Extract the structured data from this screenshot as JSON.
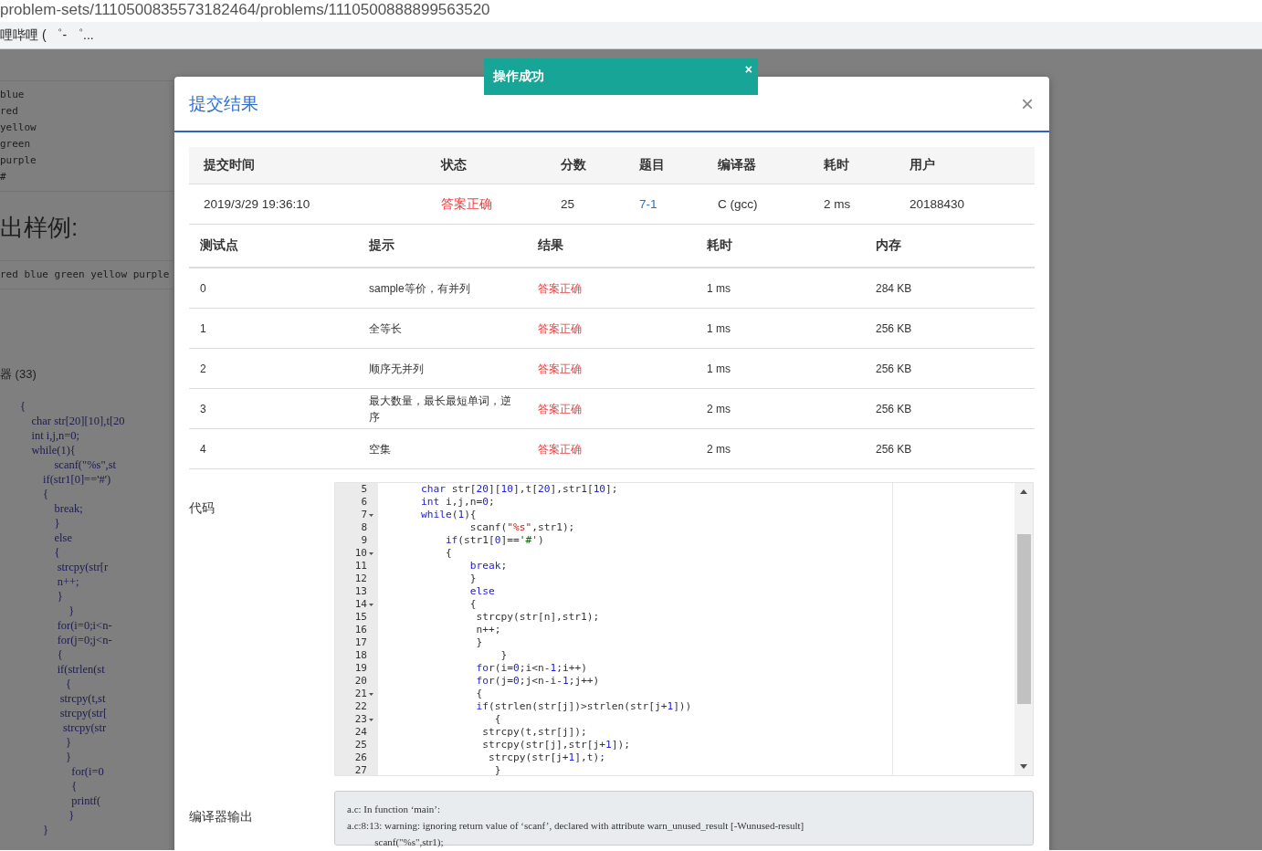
{
  "browser": {
    "url": "problem-sets/1110500835573182464/problems/1110500888899563520",
    "bookmark": "哩哔哩 ( ゜- ゜..."
  },
  "background": {
    "sample_lines": [
      "blue",
      "red",
      "yellow",
      "green",
      "purple",
      "#"
    ],
    "output_heading": "出样例:",
    "output_sample": "red blue green yellow purple",
    "submissions_label": "器 (33)",
    "code_lines": [
      "{",
      "    char str[20][10],t[20",
      "    int i,j,n=0;",
      "    while(1){",
      "            scanf(\"%s\",st",
      "        if(str1[0]=='#')",
      "        {",
      "            break;",
      "            }",
      "            else",
      "            {",
      "             strcpy(str[r",
      "             n++;",
      "             }",
      "                 }",
      "             for(i=0;i<n-",
      "             for(j=0;j<n-",
      "             {",
      "             if(strlen(st",
      "                {",
      "              strcpy(t,st",
      "              strcpy(str[",
      "               strcpy(str",
      "                }",
      "                }",
      "                  for(i=0",
      "                  {",
      "                  printf(",
      "                 }",
      "        }"
    ]
  },
  "toast": {
    "message": "操作成功",
    "close": "×"
  },
  "modal": {
    "title": "提交结果",
    "close": "×",
    "summary": {
      "columns": [
        "提交时间",
        "状态",
        "分数",
        "题目",
        "编译器",
        "耗时",
        "用户"
      ],
      "row": {
        "time": "2019/3/29 19:36:10",
        "status": "答案正确",
        "status_ok": true,
        "score": "25",
        "problem": "7-1",
        "compiler": "C (gcc)",
        "duration": "2 ms",
        "user": "20188430"
      }
    },
    "tests": {
      "columns": [
        "测试点",
        "提示",
        "结果",
        "耗时",
        "内存"
      ],
      "rows": [
        {
          "id": "0",
          "hint": "sample等价，有并列",
          "result": "答案正确",
          "ok": true,
          "time": "1 ms",
          "memory": "284 KB"
        },
        {
          "id": "1",
          "hint": "全等长",
          "result": "答案正确",
          "ok": true,
          "time": "1 ms",
          "memory": "256 KB"
        },
        {
          "id": "2",
          "hint": "顺序无并列",
          "result": "答案正确",
          "ok": true,
          "time": "1 ms",
          "memory": "256 KB"
        },
        {
          "id": "3",
          "hint": "最大数量，最长最短单词，逆序",
          "result": "答案正确",
          "ok": true,
          "time": "2 ms",
          "memory": "256 KB"
        },
        {
          "id": "4",
          "hint": "空集",
          "result": "答案正确",
          "ok": true,
          "time": "2 ms",
          "memory": "256 KB"
        }
      ]
    },
    "code_label": "代码",
    "code": [
      {
        "no": "5",
        "fold": false,
        "tokens": [
          {
            "kind": "kw",
            "text": "    char"
          },
          {
            "kind": "plain",
            "text": " str["
          },
          {
            "kind": "num",
            "text": "20"
          },
          {
            "kind": "plain",
            "text": "]["
          },
          {
            "kind": "num",
            "text": "10"
          },
          {
            "kind": "plain",
            "text": "],t["
          },
          {
            "kind": "num",
            "text": "20"
          },
          {
            "kind": "plain",
            "text": "],str1["
          },
          {
            "kind": "num",
            "text": "10"
          },
          {
            "kind": "plain",
            "text": "];"
          }
        ]
      },
      {
        "no": "6",
        "fold": false,
        "tokens": [
          {
            "kind": "kw",
            "text": "    int"
          },
          {
            "kind": "plain",
            "text": " i,j,n="
          },
          {
            "kind": "num",
            "text": "0"
          },
          {
            "kind": "plain",
            "text": ";"
          }
        ]
      },
      {
        "no": "7",
        "fold": true,
        "tokens": [
          {
            "kind": "kw",
            "text": "    while"
          },
          {
            "kind": "plain",
            "text": "("
          },
          {
            "kind": "num",
            "text": "1"
          },
          {
            "kind": "plain",
            "text": "){"
          }
        ]
      },
      {
        "no": "8",
        "fold": false,
        "tokens": [
          {
            "kind": "plain",
            "text": "            scanf("
          },
          {
            "kind": "str",
            "text": "\"%s\""
          },
          {
            "kind": "plain",
            "text": ",str1);"
          }
        ]
      },
      {
        "no": "9",
        "fold": false,
        "tokens": [
          {
            "kind": "kw",
            "text": "        if"
          },
          {
            "kind": "plain",
            "text": "(str1["
          },
          {
            "kind": "num",
            "text": "0"
          },
          {
            "kind": "plain",
            "text": "]=="
          },
          {
            "kind": "chr",
            "text": "'#'"
          },
          {
            "kind": "plain",
            "text": ")"
          }
        ]
      },
      {
        "no": "10",
        "fold": true,
        "tokens": [
          {
            "kind": "plain",
            "text": "        {"
          }
        ]
      },
      {
        "no": "11",
        "fold": false,
        "tokens": [
          {
            "kind": "kw",
            "text": "            break"
          },
          {
            "kind": "plain",
            "text": ";"
          }
        ]
      },
      {
        "no": "12",
        "fold": false,
        "tokens": [
          {
            "kind": "plain",
            "text": "            }"
          }
        ]
      },
      {
        "no": "13",
        "fold": false,
        "tokens": [
          {
            "kind": "kw",
            "text": "            else"
          }
        ]
      },
      {
        "no": "14",
        "fold": true,
        "tokens": [
          {
            "kind": "plain",
            "text": "            {"
          }
        ]
      },
      {
        "no": "15",
        "fold": false,
        "tokens": [
          {
            "kind": "plain",
            "text": "             strcpy(str[n],str1);"
          }
        ]
      },
      {
        "no": "16",
        "fold": false,
        "tokens": [
          {
            "kind": "plain",
            "text": "             n++;"
          }
        ]
      },
      {
        "no": "17",
        "fold": false,
        "tokens": [
          {
            "kind": "plain",
            "text": "             }"
          }
        ]
      },
      {
        "no": "18",
        "fold": false,
        "tokens": [
          {
            "kind": "plain",
            "text": "                 }"
          }
        ]
      },
      {
        "no": "19",
        "fold": false,
        "tokens": [
          {
            "kind": "kw",
            "text": "             for"
          },
          {
            "kind": "plain",
            "text": "(i="
          },
          {
            "kind": "num",
            "text": "0"
          },
          {
            "kind": "plain",
            "text": ";i<n-"
          },
          {
            "kind": "num",
            "text": "1"
          },
          {
            "kind": "plain",
            "text": ";i++)"
          }
        ]
      },
      {
        "no": "20",
        "fold": false,
        "tokens": [
          {
            "kind": "kw",
            "text": "             for"
          },
          {
            "kind": "plain",
            "text": "(j="
          },
          {
            "kind": "num",
            "text": "0"
          },
          {
            "kind": "plain",
            "text": ";j<n-i-"
          },
          {
            "kind": "num",
            "text": "1"
          },
          {
            "kind": "plain",
            "text": ";j++)"
          }
        ]
      },
      {
        "no": "21",
        "fold": true,
        "tokens": [
          {
            "kind": "plain",
            "text": "             {"
          }
        ]
      },
      {
        "no": "22",
        "fold": false,
        "tokens": [
          {
            "kind": "kw",
            "text": "             if"
          },
          {
            "kind": "plain",
            "text": "(strlen(str[j])>strlen(str[j+"
          },
          {
            "kind": "num",
            "text": "1"
          },
          {
            "kind": "plain",
            "text": "]))"
          }
        ]
      },
      {
        "no": "23",
        "fold": true,
        "tokens": [
          {
            "kind": "plain",
            "text": "                {"
          }
        ]
      },
      {
        "no": "24",
        "fold": false,
        "tokens": [
          {
            "kind": "plain",
            "text": "              strcpy(t,str[j]);"
          }
        ]
      },
      {
        "no": "25",
        "fold": false,
        "tokens": [
          {
            "kind": "plain",
            "text": "              strcpy(str[j],str[j+"
          },
          {
            "kind": "num",
            "text": "1"
          },
          {
            "kind": "plain",
            "text": "]);"
          }
        ]
      },
      {
        "no": "26",
        "fold": false,
        "tokens": [
          {
            "kind": "plain",
            "text": "               strcpy(str[j+"
          },
          {
            "kind": "num",
            "text": "1"
          },
          {
            "kind": "plain",
            "text": "],t);"
          }
        ]
      },
      {
        "no": "27",
        "fold": false,
        "tokens": [
          {
            "kind": "plain",
            "text": "                }"
          }
        ]
      }
    ],
    "compiler_label": "编译器输出",
    "compiler_output": [
      "a.c: In function ‘main’:",
      "a.c:8:13: warning: ignoring return value of ‘scanf’, declared with attribute warn_unused_result [-Wunused-result]",
      "           scanf(\"%s\",str1);"
    ]
  }
}
